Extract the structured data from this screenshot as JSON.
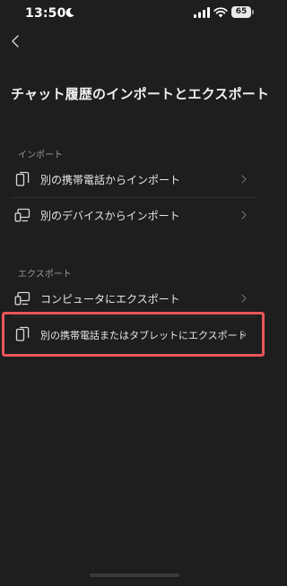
{
  "status_bar": {
    "time": "13:50",
    "battery": "65",
    "icons": [
      "moon-icon",
      "signal-icon",
      "wifi-icon",
      "battery-icon"
    ]
  },
  "header": {
    "back_icon": "chevron-left-icon",
    "title": "チャット履歴のインポートとエクスポート"
  },
  "import_section": {
    "header": "インポート",
    "items": [
      {
        "label": "別の携帯電話からインポート",
        "icon": "phone-icon"
      },
      {
        "label": "別のデバイスからインポート",
        "icon": "devices-icon"
      }
    ]
  },
  "export_section": {
    "header": "エクスポート",
    "items": [
      {
        "label": "コンピュータにエクスポート",
        "icon": "devices-icon"
      },
      {
        "label": "別の携帯電話またはタブレットにエクスポート",
        "icon": "phone-icon"
      }
    ]
  },
  "colors": {
    "background": "#1e1e1e",
    "text": "#e9e9e9",
    "section_header": "#9a9a9a",
    "highlight": "#e8555a"
  }
}
